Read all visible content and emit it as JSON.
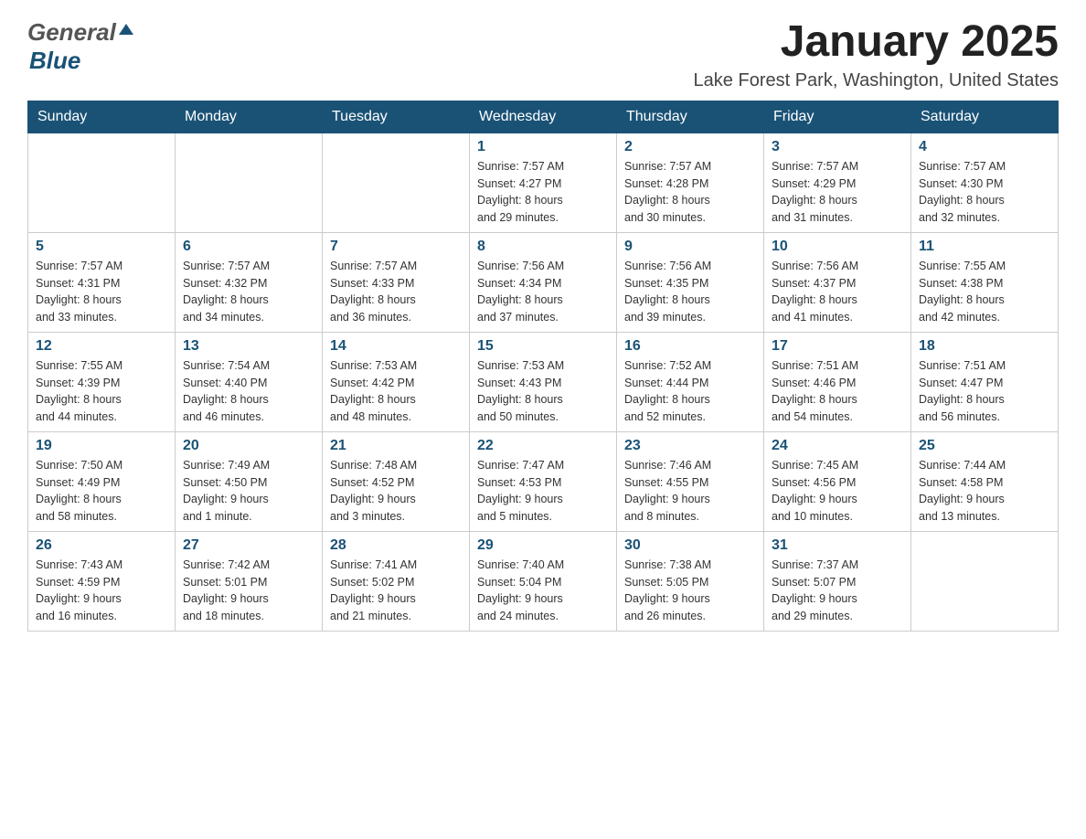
{
  "header": {
    "logo_general": "General",
    "logo_blue": "Blue",
    "month_title": "January 2025",
    "location": "Lake Forest Park, Washington, United States"
  },
  "weekdays": [
    "Sunday",
    "Monday",
    "Tuesday",
    "Wednesday",
    "Thursday",
    "Friday",
    "Saturday"
  ],
  "weeks": [
    [
      {
        "day": "",
        "info": ""
      },
      {
        "day": "",
        "info": ""
      },
      {
        "day": "",
        "info": ""
      },
      {
        "day": "1",
        "info": "Sunrise: 7:57 AM\nSunset: 4:27 PM\nDaylight: 8 hours\nand 29 minutes."
      },
      {
        "day": "2",
        "info": "Sunrise: 7:57 AM\nSunset: 4:28 PM\nDaylight: 8 hours\nand 30 minutes."
      },
      {
        "day": "3",
        "info": "Sunrise: 7:57 AM\nSunset: 4:29 PM\nDaylight: 8 hours\nand 31 minutes."
      },
      {
        "day": "4",
        "info": "Sunrise: 7:57 AM\nSunset: 4:30 PM\nDaylight: 8 hours\nand 32 minutes."
      }
    ],
    [
      {
        "day": "5",
        "info": "Sunrise: 7:57 AM\nSunset: 4:31 PM\nDaylight: 8 hours\nand 33 minutes."
      },
      {
        "day": "6",
        "info": "Sunrise: 7:57 AM\nSunset: 4:32 PM\nDaylight: 8 hours\nand 34 minutes."
      },
      {
        "day": "7",
        "info": "Sunrise: 7:57 AM\nSunset: 4:33 PM\nDaylight: 8 hours\nand 36 minutes."
      },
      {
        "day": "8",
        "info": "Sunrise: 7:56 AM\nSunset: 4:34 PM\nDaylight: 8 hours\nand 37 minutes."
      },
      {
        "day": "9",
        "info": "Sunrise: 7:56 AM\nSunset: 4:35 PM\nDaylight: 8 hours\nand 39 minutes."
      },
      {
        "day": "10",
        "info": "Sunrise: 7:56 AM\nSunset: 4:37 PM\nDaylight: 8 hours\nand 41 minutes."
      },
      {
        "day": "11",
        "info": "Sunrise: 7:55 AM\nSunset: 4:38 PM\nDaylight: 8 hours\nand 42 minutes."
      }
    ],
    [
      {
        "day": "12",
        "info": "Sunrise: 7:55 AM\nSunset: 4:39 PM\nDaylight: 8 hours\nand 44 minutes."
      },
      {
        "day": "13",
        "info": "Sunrise: 7:54 AM\nSunset: 4:40 PM\nDaylight: 8 hours\nand 46 minutes."
      },
      {
        "day": "14",
        "info": "Sunrise: 7:53 AM\nSunset: 4:42 PM\nDaylight: 8 hours\nand 48 minutes."
      },
      {
        "day": "15",
        "info": "Sunrise: 7:53 AM\nSunset: 4:43 PM\nDaylight: 8 hours\nand 50 minutes."
      },
      {
        "day": "16",
        "info": "Sunrise: 7:52 AM\nSunset: 4:44 PM\nDaylight: 8 hours\nand 52 minutes."
      },
      {
        "day": "17",
        "info": "Sunrise: 7:51 AM\nSunset: 4:46 PM\nDaylight: 8 hours\nand 54 minutes."
      },
      {
        "day": "18",
        "info": "Sunrise: 7:51 AM\nSunset: 4:47 PM\nDaylight: 8 hours\nand 56 minutes."
      }
    ],
    [
      {
        "day": "19",
        "info": "Sunrise: 7:50 AM\nSunset: 4:49 PM\nDaylight: 8 hours\nand 58 minutes."
      },
      {
        "day": "20",
        "info": "Sunrise: 7:49 AM\nSunset: 4:50 PM\nDaylight: 9 hours\nand 1 minute."
      },
      {
        "day": "21",
        "info": "Sunrise: 7:48 AM\nSunset: 4:52 PM\nDaylight: 9 hours\nand 3 minutes."
      },
      {
        "day": "22",
        "info": "Sunrise: 7:47 AM\nSunset: 4:53 PM\nDaylight: 9 hours\nand 5 minutes."
      },
      {
        "day": "23",
        "info": "Sunrise: 7:46 AM\nSunset: 4:55 PM\nDaylight: 9 hours\nand 8 minutes."
      },
      {
        "day": "24",
        "info": "Sunrise: 7:45 AM\nSunset: 4:56 PM\nDaylight: 9 hours\nand 10 minutes."
      },
      {
        "day": "25",
        "info": "Sunrise: 7:44 AM\nSunset: 4:58 PM\nDaylight: 9 hours\nand 13 minutes."
      }
    ],
    [
      {
        "day": "26",
        "info": "Sunrise: 7:43 AM\nSunset: 4:59 PM\nDaylight: 9 hours\nand 16 minutes."
      },
      {
        "day": "27",
        "info": "Sunrise: 7:42 AM\nSunset: 5:01 PM\nDaylight: 9 hours\nand 18 minutes."
      },
      {
        "day": "28",
        "info": "Sunrise: 7:41 AM\nSunset: 5:02 PM\nDaylight: 9 hours\nand 21 minutes."
      },
      {
        "day": "29",
        "info": "Sunrise: 7:40 AM\nSunset: 5:04 PM\nDaylight: 9 hours\nand 24 minutes."
      },
      {
        "day": "30",
        "info": "Sunrise: 7:38 AM\nSunset: 5:05 PM\nDaylight: 9 hours\nand 26 minutes."
      },
      {
        "day": "31",
        "info": "Sunrise: 7:37 AM\nSunset: 5:07 PM\nDaylight: 9 hours\nand 29 minutes."
      },
      {
        "day": "",
        "info": ""
      }
    ]
  ]
}
